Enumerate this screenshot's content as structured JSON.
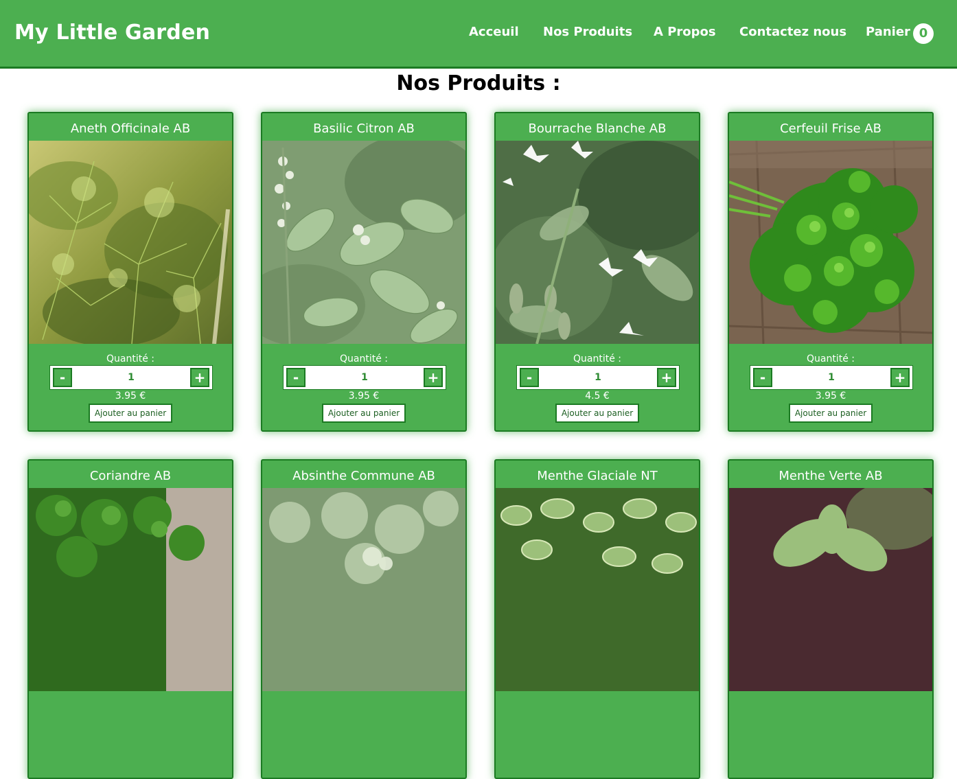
{
  "header": {
    "brand": "My Little Garden",
    "nav": [
      "Acceuil",
      "Nos Produits",
      "A Propos",
      "Contactez nous"
    ],
    "cart_label": "Panier",
    "cart_count": "0"
  },
  "page_title": "Nos Produits :",
  "colors": {
    "primary": "#4caf50",
    "primary_dark": "#1b7a22",
    "text_on_primary": "#ffffff"
  },
  "products": [
    {
      "name": "Aneth Officinale AB",
      "qty_label": "Quantité :",
      "minus": "-",
      "plus": "+",
      "quantity": "1",
      "price": "3.95 €",
      "add_label": "Ajouter au panier",
      "image": "dill-photo"
    },
    {
      "name": "Basilic Citron AB",
      "qty_label": "Quantité :",
      "minus": "-",
      "plus": "+",
      "quantity": "1",
      "price": "3.95 €",
      "add_label": "Ajouter au panier",
      "image": "lemon-basil-photo"
    },
    {
      "name": "Bourrache Blanche AB",
      "qty_label": "Quantité :",
      "minus": "-",
      "plus": "+",
      "quantity": "1",
      "price": "4.5 €",
      "add_label": "Ajouter au panier",
      "image": "white-borage-photo"
    },
    {
      "name": "Cerfeuil Frise AB",
      "qty_label": "Quantité :",
      "minus": "-",
      "plus": "+",
      "quantity": "1",
      "price": "3.95 €",
      "add_label": "Ajouter au panier",
      "image": "curly-chervil-photo"
    },
    {
      "name": "Coriandre AB",
      "image": "coriander-photo"
    },
    {
      "name": "Absinthe Commune AB",
      "image": "wormwood-photo"
    },
    {
      "name": "Menthe Glaciale NT",
      "image": "ice-mint-photo"
    },
    {
      "name": "Menthe Verte AB",
      "image": "spearmint-photo"
    }
  ]
}
